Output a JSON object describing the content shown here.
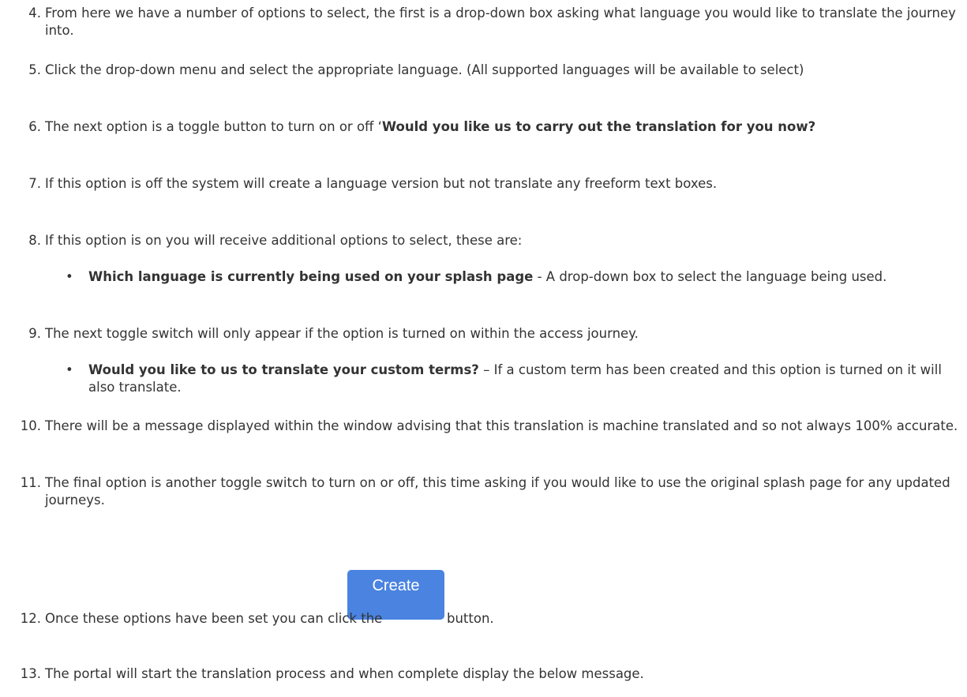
{
  "steps": [
    {
      "num": "4.",
      "text": "From here we have a number of options to select, the first is a drop-down box asking what language you would like to translate the journey into."
    },
    {
      "num": "5.",
      "text": "Click the drop-down menu and select the appropriate language. (All supported languages will be available to select)"
    },
    {
      "num": "6.",
      "text_pre": "The next option is a toggle button to turn on or off ‘",
      "text_bold": "Would you like us to carry out the translation for you now?"
    },
    {
      "num": "7.",
      "text": "If this option is off the system will create a language version but not translate any freeform text boxes."
    },
    {
      "num": "8.",
      "text": "If this option is on you will receive additional options to select, these are:"
    },
    {
      "num": "9.",
      "text": "The next toggle switch will only appear if the option is turned on within the access journey."
    },
    {
      "num": "10.",
      "text": "There will be a message displayed within the window advising that this translation is machine translated and so not always 100% accurate."
    },
    {
      "num": "11.",
      "text": "The final option is another toggle switch to turn on or off, this time asking if you would like to use the original splash page for any updated journeys."
    },
    {
      "num": "12.",
      "text": "Once these options have been set you can click the",
      "suffix": "button."
    },
    {
      "num": "13.",
      "text": "The portal will start the translation process and when complete display the below message."
    }
  ],
  "bullets": [
    {
      "dot": "•",
      "bold": "Which language is currently being used on your splash page",
      "text": " - A drop-down box to select the language being used."
    },
    {
      "dot": "•",
      "bold": "Would you like to us to translate your custom terms?",
      "text": " – If a custom term has been created and this option is turned on it will also translate."
    }
  ],
  "create_button": {
    "label": "Create",
    "color": "#4a83e0"
  }
}
